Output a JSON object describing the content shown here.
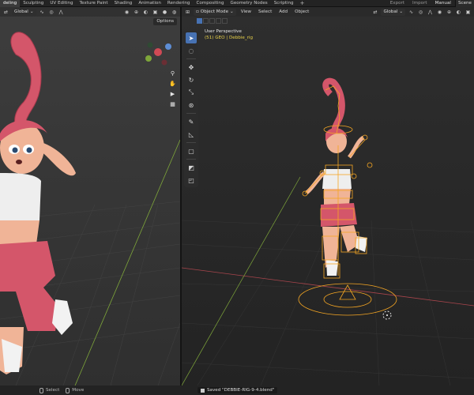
{
  "workspace_tabs": [
    {
      "label": "deling",
      "active": true
    },
    {
      "label": "Sculpting",
      "active": false
    },
    {
      "label": "UV Editing",
      "active": false
    },
    {
      "label": "Texture Paint",
      "active": false
    },
    {
      "label": "Shading",
      "active": false
    },
    {
      "label": "Animation",
      "active": false
    },
    {
      "label": "Rendering",
      "active": false
    },
    {
      "label": "Compositing",
      "active": false
    },
    {
      "label": "Geometry Nodes",
      "active": false
    },
    {
      "label": "Scripting",
      "active": false
    }
  ],
  "add_tab_glyph": "+",
  "top_right": {
    "export_label": "Export",
    "import_label": "Import",
    "manual_label": "Manual",
    "scene_label": "Scene"
  },
  "left_viewport": {
    "transform_label": "Global",
    "options_label": "Options"
  },
  "right_viewport": {
    "mode_label": "Object Mode",
    "menus": [
      "View",
      "Select",
      "Add",
      "Object"
    ],
    "transform_label": "Global",
    "view_title": "User Perspective",
    "collection_text": "(51) GEO | Debbie_rig"
  },
  "status": {
    "select_label": "Select",
    "move_label": "Move",
    "saved_message": "Saved \"DEBBIE-RIG-9-4.blend\""
  },
  "colors": {
    "accent_active": "#4772b3",
    "armature": "#f5a623",
    "grid_x_axis": "#a8454c",
    "grid_y_axis": "#7ea63a",
    "info_text_yellow": "#e9d24a"
  }
}
